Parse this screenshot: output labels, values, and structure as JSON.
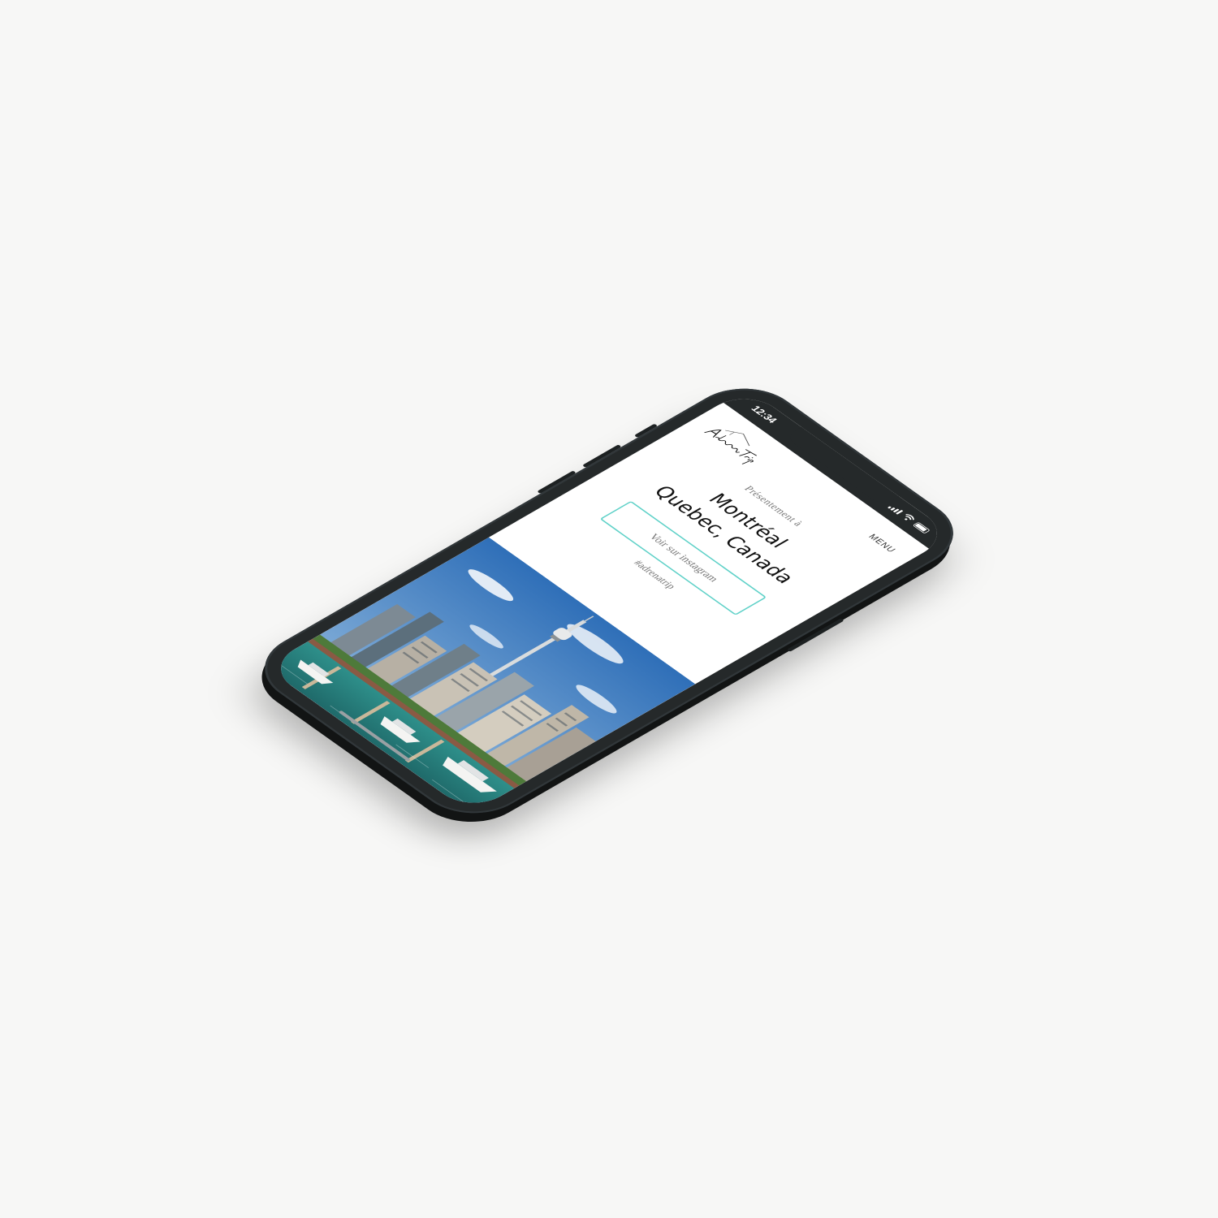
{
  "status_bar": {
    "time": "12:34",
    "icons": [
      "signal-icon",
      "wifi-icon",
      "battery-icon"
    ]
  },
  "header": {
    "logo_text": "AdrenaTrip",
    "menu_label": "MENU"
  },
  "hero": {
    "presently_label": "Présentement  à",
    "city_line1": "Montréal",
    "city_line2": "Quebec, Canada",
    "instagram_button": "Voir sur instagram",
    "hashtag": "#adrenatrip"
  },
  "colors": {
    "accent": "#5fd1c8",
    "phone_body": "#25292a",
    "background": "#f7f7f6",
    "text_dark": "#111111",
    "text_muted": "#777777"
  }
}
